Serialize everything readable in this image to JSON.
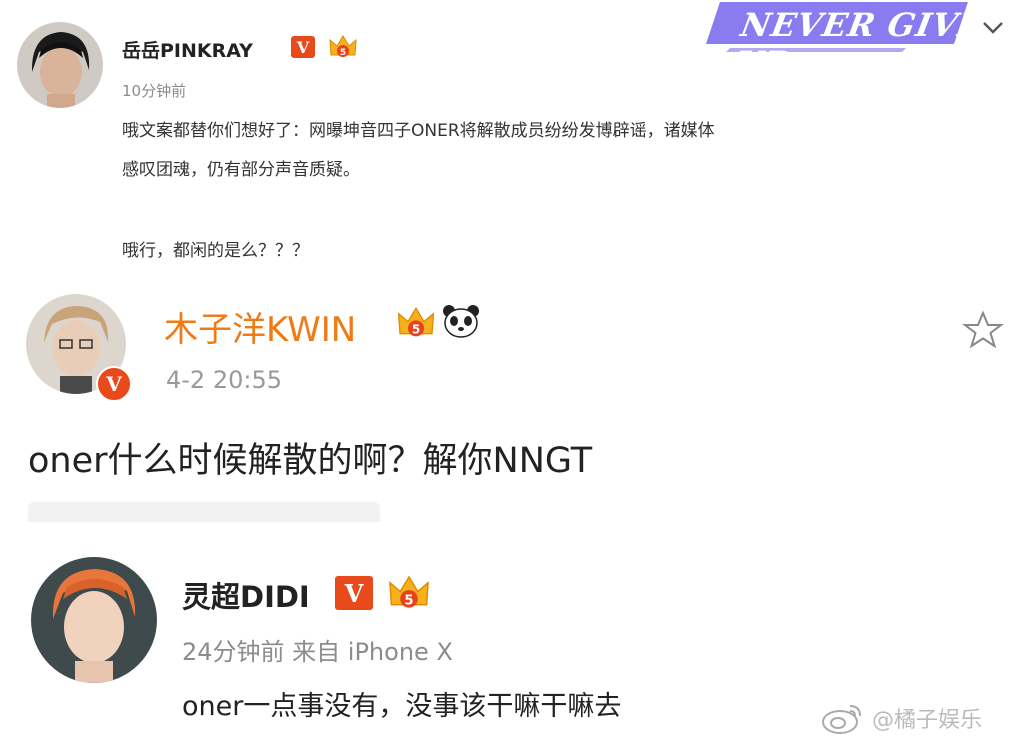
{
  "post1": {
    "username": "岳岳PINKRAY",
    "verified_badge": "V",
    "crown_level": "5",
    "time": "10分钟前",
    "text_line1": "哦文案都替你们想好了：网曝坤音四子ONER将解散成员纷纷发博辟谣，诸媒体",
    "text_line2": "感叹团魂，仍有部分声音质疑。",
    "text_line3": "哦行，都闲的是么？？？",
    "banner_text": "NEVER GIVE UP",
    "colors": {
      "banner": "#8a7cf0",
      "badge": "#e84a1c"
    }
  },
  "post2": {
    "username": "木子洋KWIN",
    "verified_badge": "V",
    "crown_level": "5",
    "time": "4-2 20:55",
    "text": "oner什么时候解散的啊？解你NNGT",
    "colors": {
      "username": "#f07a14"
    }
  },
  "post3": {
    "username": "灵超DIDI",
    "verified_badge": "V",
    "crown_level": "5",
    "time_source": "24分钟前 来自 iPhone X",
    "text": "oner一点事没有，没事该干嘛干嘛去",
    "watermark": "@橘子娱乐"
  },
  "icons": [
    "crown-icon",
    "panda-icon",
    "star-icon",
    "chevron-down-icon",
    "weibo-logo-icon"
  ]
}
